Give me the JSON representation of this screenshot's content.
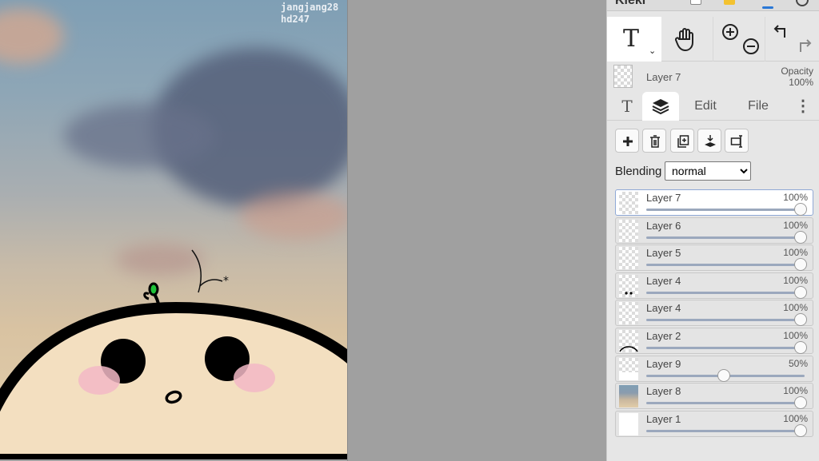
{
  "canvas": {
    "watermark": [
      "jangjang28",
      "hd247"
    ]
  },
  "panel": {
    "brand": "Kleki",
    "current_layer": {
      "name": "Layer 7",
      "opacity_label": "Opacity",
      "opacity_value": "100%"
    },
    "tabs": {
      "text": "T",
      "edit": "Edit",
      "file": "File",
      "more": "⋮"
    },
    "blending": {
      "label": "Blending",
      "value": "normal",
      "options": [
        "normal"
      ]
    },
    "layers": [
      {
        "name": "Layer 7",
        "opacity": "100%",
        "level": 1.0,
        "active": true,
        "thumb": "empty"
      },
      {
        "name": "Layer 6",
        "opacity": "100%",
        "level": 1.0,
        "active": false,
        "thumb": "empty"
      },
      {
        "name": "Layer 5",
        "opacity": "100%",
        "level": 1.0,
        "active": false,
        "thumb": "empty"
      },
      {
        "name": "Layer 4",
        "opacity": "100%",
        "level": 1.0,
        "active": false,
        "thumb": "eyes"
      },
      {
        "name": "Layer 4",
        "opacity": "100%",
        "level": 1.0,
        "active": false,
        "thumb": "empty"
      },
      {
        "name": "Layer 2",
        "opacity": "100%",
        "level": 1.0,
        "active": false,
        "thumb": "arc"
      },
      {
        "name": "Layer 9",
        "opacity": "50%",
        "level": 0.5,
        "active": false,
        "thumb": "white-bottom"
      },
      {
        "name": "Layer 8",
        "opacity": "100%",
        "level": 1.0,
        "active": false,
        "thumb": "photo"
      },
      {
        "name": "Layer 1",
        "opacity": "100%",
        "level": 1.0,
        "active": false,
        "thumb": "white"
      }
    ]
  }
}
